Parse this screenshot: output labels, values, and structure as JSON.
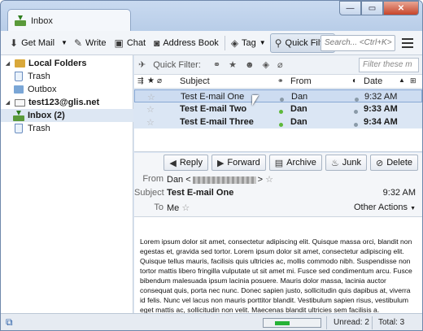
{
  "window": {
    "tab_title": "Inbox",
    "controls": {
      "minimize": "—",
      "maximize": "▭",
      "close": "✕"
    }
  },
  "toolbar": {
    "get_mail": "Get Mail",
    "write": "Write",
    "chat": "Chat",
    "address_book": "Address Book",
    "tag": "Tag",
    "quick_filter": "Quick Filter",
    "search_placeholder": "Search... <Ctrl+K>"
  },
  "folders": {
    "local_folders": "Local Folders",
    "trash_local": "Trash",
    "outbox": "Outbox",
    "account": "test123@glis.net",
    "inbox": "Inbox (2)",
    "trash_account": "Trash"
  },
  "quick_filter": {
    "label": "Quick Filter:",
    "placeholder": "Filter these m"
  },
  "columns": {
    "subject": "Subject",
    "from": "From",
    "date": "Date"
  },
  "messages": [
    {
      "subject": "Test E-mail One",
      "from": "Dan",
      "date": "9:32 AM",
      "unread": false,
      "selected": true,
      "dot_color": "#8a9aa8"
    },
    {
      "subject": "Test E-mail Two",
      "from": "Dan",
      "date": "9:33 AM",
      "unread": true,
      "selected": false,
      "dot_color": "#5db83a"
    },
    {
      "subject": "Test E-mail Three",
      "from": "Dan",
      "date": "9:34 AM",
      "unread": true,
      "selected": false,
      "dot_color": "#5db83a"
    }
  ],
  "message_actions": {
    "reply": "Reply",
    "forward": "Forward",
    "archive": "Archive",
    "junk": "Junk",
    "delete": "Delete"
  },
  "message_header": {
    "from_label": "From",
    "from_value": "Dan <",
    "from_close": ">",
    "subject_label": "Subject",
    "subject_value": "Test E-mail One",
    "time": "9:32 AM",
    "to_label": "To",
    "to_value": "Me",
    "other_actions": "Other Actions"
  },
  "body_text": "Lorem ipsum dolor sit amet, consectetur adipiscing elit. Quisque massa orci, blandit non egestas et, gravida sed tortor. Lorem ipsum dolor sit amet, consectetur adipiscing elit. Quisque tellus mauris, facilisis quis ultricies ac, mollis commodo nibh. Suspendisse non tortor mattis libero fringilla vulputate ut sit amet mi. Fusce sed condimentum arcu. Fusce bibendum malesuada ipsum lacinia posuere. Mauris dolor massa, lacinia auctor consequat quis, porta nec nunc. Donec sapien justo, sollicitudin quis dapibus at, viverra id felis. Nunc vel lacus non mauris porttitor blandit. Vestibulum sapien risus, vestibulum eget mattis ac, sollicitudin non velit. Maecenas blandit ultricies sem facilisis a.",
  "status": {
    "unread": "Unread: 2",
    "total": "Total: 3",
    "progress_fraction": 0.4
  }
}
